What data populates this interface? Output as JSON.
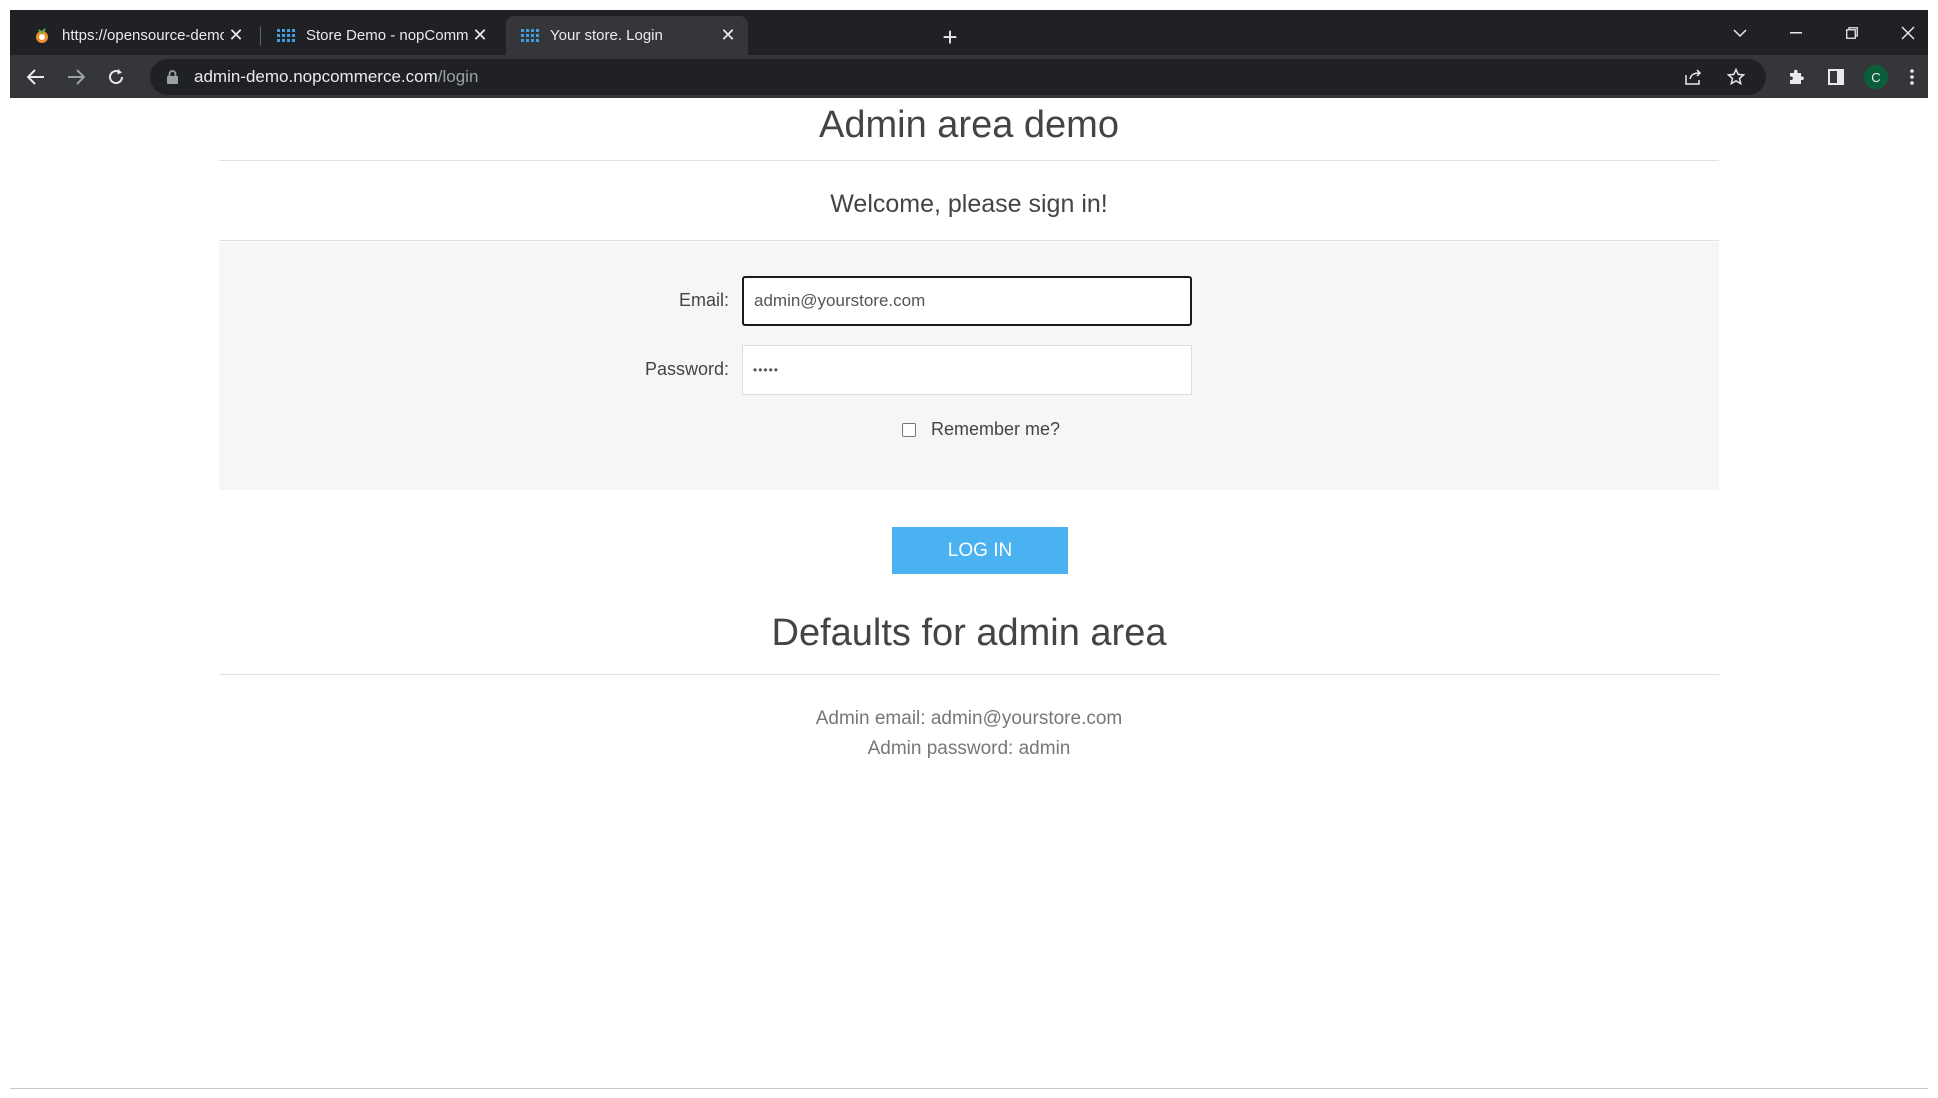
{
  "browser": {
    "tabs": [
      {
        "title": "https://opensource-demo.orangehrmlive.com",
        "icon": "orangehrm-favicon",
        "active": false
      },
      {
        "title": "Store Demo - nopCommerce",
        "icon": "nopcommerce-favicon",
        "active": false
      },
      {
        "title": "Your store. Login",
        "icon": "nopcommerce-favicon",
        "active": true
      }
    ],
    "url_host": "admin-demo.nopcommerce.com",
    "url_path": "/login",
    "profile_initial": "C"
  },
  "page": {
    "title": "Admin area demo",
    "welcome": "Welcome, please sign in!",
    "form": {
      "email_label": "Email:",
      "email_value": "admin@yourstore.com",
      "password_label": "Password:",
      "password_value": "•••••",
      "remember_label": "Remember me?",
      "remember_checked": false
    },
    "login_button": "LOG IN",
    "defaults_title": "Defaults for admin area",
    "admin_email_line": "Admin email: admin@yourstore.com",
    "admin_password_line": "Admin password: admin"
  },
  "colors": {
    "accent": "#4ab2f1",
    "chrome_dark": "#202124",
    "chrome_mid": "#35363a",
    "form_bg": "#f6f6f6"
  }
}
